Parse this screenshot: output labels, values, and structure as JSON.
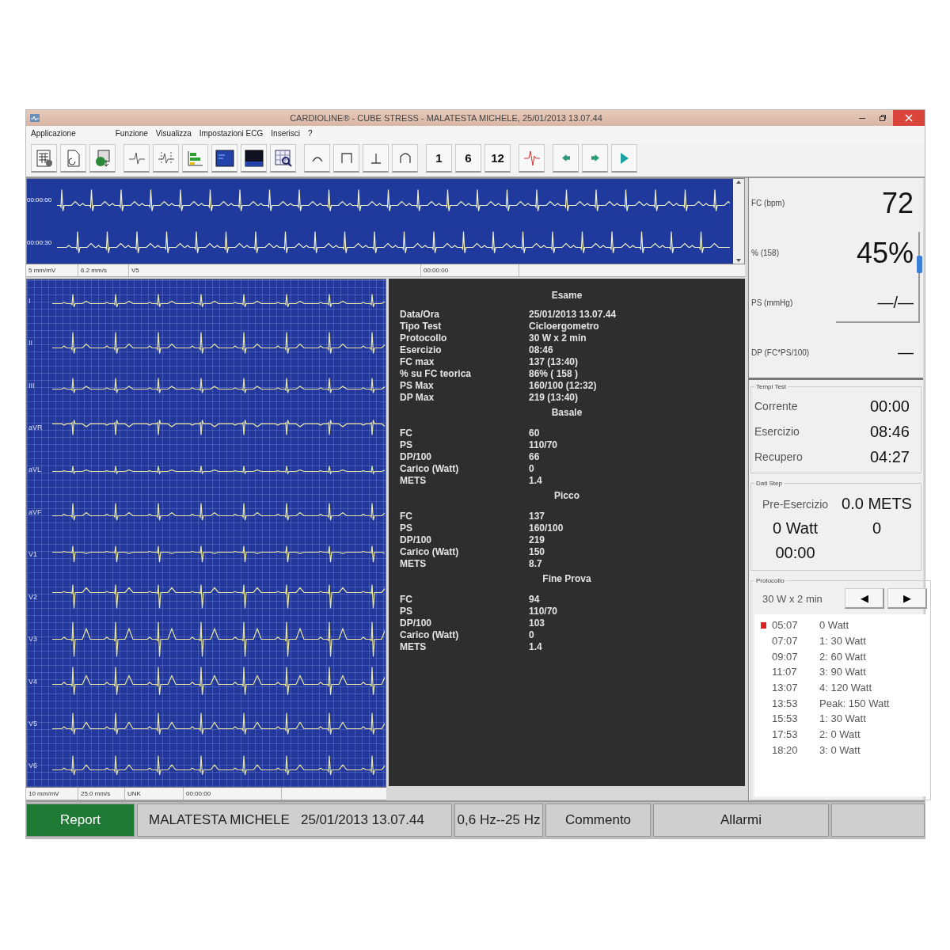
{
  "window": {
    "title": "CARDIOLINE® - CUBE STRESS - MALATESTA MICHELE, 25/01/2013 13.07.44"
  },
  "menu": [
    "Applicazione",
    "Funzione",
    "Visualizza",
    "Impostazioni ECG",
    "Inserisci",
    "?"
  ],
  "toolbar": {
    "number_buttons": [
      "1",
      "6",
      "12"
    ]
  },
  "rhythm_strip": {
    "rows": [
      "00:00:00",
      "00:00:30"
    ],
    "status": [
      "5 mm/mV",
      "6.2 mm/s",
      "V5",
      "00:00:00"
    ]
  },
  "leads": {
    "labels": [
      "I",
      "II",
      "III",
      "aVR",
      "aVL",
      "aVF",
      "V1",
      "V2",
      "V3",
      "V4",
      "V5",
      "V6"
    ],
    "status": [
      "10 mm/mV",
      "25.0 mm/s",
      "UNK",
      "00:00:00"
    ]
  },
  "summary": {
    "sections": [
      {
        "title": "Esame",
        "rows": [
          [
            "Data/Ora",
            "25/01/2013 13.07.44"
          ],
          [
            "Tipo Test",
            "Cicloergometro"
          ],
          [
            "Protocollo",
            "30 W x 2 min"
          ],
          [
            "Esercizio",
            "08:46"
          ],
          [
            "FC max",
            "137 (13:40)"
          ],
          [
            "% su FC teorica",
            "86% ( 158 )"
          ],
          [
            "PS Max",
            "160/100 (12:32)"
          ],
          [
            "DP Max",
            "219 (13:40)"
          ]
        ]
      },
      {
        "title": "Basale",
        "rows": [
          [
            "FC",
            "60"
          ],
          [
            "PS",
            "110/70"
          ],
          [
            "DP/100",
            "66"
          ],
          [
            "Carico (Watt)",
            "0"
          ],
          [
            "METS",
            "1.4"
          ]
        ]
      },
      {
        "title": "Picco",
        "rows": [
          [
            "FC",
            "137"
          ],
          [
            "PS",
            "160/100"
          ],
          [
            "DP/100",
            "219"
          ],
          [
            "Carico (Watt)",
            "150"
          ],
          [
            "METS",
            "8.7"
          ]
        ]
      },
      {
        "title": "Fine Prova",
        "rows": [
          [
            "FC",
            "94"
          ],
          [
            "PS",
            "110/70"
          ],
          [
            "DP/100",
            "103"
          ],
          [
            "Carico (Watt)",
            "0"
          ],
          [
            "METS",
            "1.4"
          ]
        ]
      }
    ]
  },
  "vitals": [
    {
      "label": "FC (bpm)",
      "value": "72"
    },
    {
      "label": "% (158)",
      "value": "45%"
    },
    {
      "label": "PS (mmHg)",
      "value": "—/—"
    },
    {
      "label": "DP (FC*PS/100)",
      "value": "—"
    }
  ],
  "test_times": {
    "title": "Tempi Test",
    "rows": [
      [
        "Corrente",
        "00:00"
      ],
      [
        "Esercizio",
        "08:46"
      ],
      [
        "Recupero",
        "04:27"
      ]
    ]
  },
  "step_data": {
    "title": "Dati Step",
    "phase": "Pre-Esercizio",
    "mets": "0.0 METS",
    "watt": "0 Watt",
    "value": "0",
    "time": "00:00"
  },
  "protocol": {
    "title": "Protocollo",
    "name": "30 W x 2 min",
    "prev": "◀",
    "next": "▶",
    "steps": [
      {
        "time": "05:07",
        "step": "0 Watt",
        "current": true
      },
      {
        "time": "07:07",
        "step": "1: 30 Watt",
        "current": false
      },
      {
        "time": "09:07",
        "step": "2: 60 Watt",
        "current": false
      },
      {
        "time": "11:07",
        "step": "3: 90 Watt",
        "current": false
      },
      {
        "time": "13:07",
        "step": "4: 120 Watt",
        "current": false
      },
      {
        "time": "13:53",
        "step": "Peak: 150 Watt",
        "current": false
      },
      {
        "time": "15:53",
        "step": "1: 30 Watt",
        "current": false
      },
      {
        "time": "17:53",
        "step": "2: 0 Watt",
        "current": false
      },
      {
        "time": "18:20",
        "step": "3: 0 Watt",
        "current": false
      }
    ]
  },
  "status_bar": [
    {
      "kind": "button",
      "label": "Report",
      "selected": true
    },
    {
      "kind": "patient",
      "name": "MALATESTA MICHELE",
      "datetime": "25/01/2013 13.07.44"
    },
    {
      "kind": "field",
      "text": "0,6 Hz--25 Hz"
    },
    {
      "kind": "button",
      "label": "Commento",
      "selected": false
    },
    {
      "kind": "button",
      "label": "Allarmi",
      "selected": false
    },
    {
      "kind": "blank"
    }
  ]
}
